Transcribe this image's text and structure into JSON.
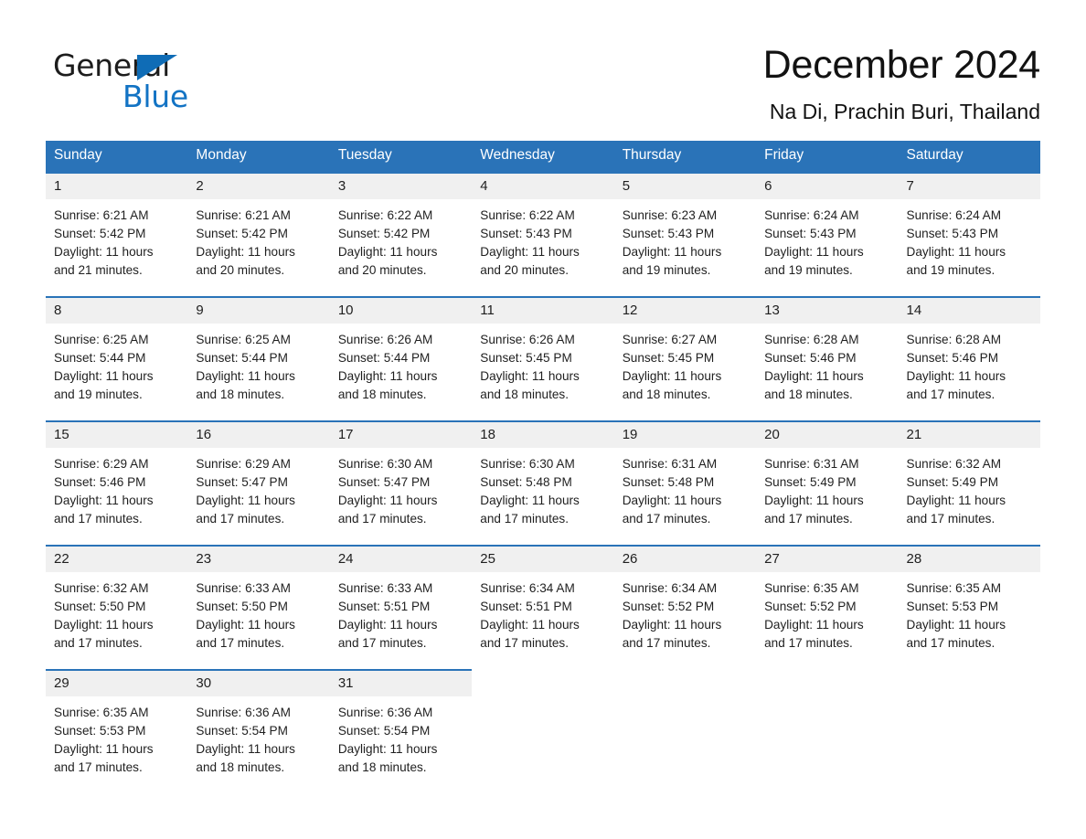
{
  "brand": {
    "word_one": "General",
    "word_two": "Blue",
    "triangle_icon": "triangle-logo-icon"
  },
  "header": {
    "month_title": "December 2024",
    "location": "Na Di, Prachin Buri, Thailand"
  },
  "calendar": {
    "weekday_headers": [
      "Sunday",
      "Monday",
      "Tuesday",
      "Wednesday",
      "Thursday",
      "Friday",
      "Saturday"
    ],
    "accent_color": "#2a73b8",
    "daynum_band_color": "#f0f0f0",
    "weeks": [
      [
        {
          "day": "1",
          "sunrise": "Sunrise: 6:21 AM",
          "sunset": "Sunset: 5:42 PM",
          "daylight_line1": "Daylight: 11 hours",
          "daylight_line2": "and 21 minutes."
        },
        {
          "day": "2",
          "sunrise": "Sunrise: 6:21 AM",
          "sunset": "Sunset: 5:42 PM",
          "daylight_line1": "Daylight: 11 hours",
          "daylight_line2": "and 20 minutes."
        },
        {
          "day": "3",
          "sunrise": "Sunrise: 6:22 AM",
          "sunset": "Sunset: 5:42 PM",
          "daylight_line1": "Daylight: 11 hours",
          "daylight_line2": "and 20 minutes."
        },
        {
          "day": "4",
          "sunrise": "Sunrise: 6:22 AM",
          "sunset": "Sunset: 5:43 PM",
          "daylight_line1": "Daylight: 11 hours",
          "daylight_line2": "and 20 minutes."
        },
        {
          "day": "5",
          "sunrise": "Sunrise: 6:23 AM",
          "sunset": "Sunset: 5:43 PM",
          "daylight_line1": "Daylight: 11 hours",
          "daylight_line2": "and 19 minutes."
        },
        {
          "day": "6",
          "sunrise": "Sunrise: 6:24 AM",
          "sunset": "Sunset: 5:43 PM",
          "daylight_line1": "Daylight: 11 hours",
          "daylight_line2": "and 19 minutes."
        },
        {
          "day": "7",
          "sunrise": "Sunrise: 6:24 AM",
          "sunset": "Sunset: 5:43 PM",
          "daylight_line1": "Daylight: 11 hours",
          "daylight_line2": "and 19 minutes."
        }
      ],
      [
        {
          "day": "8",
          "sunrise": "Sunrise: 6:25 AM",
          "sunset": "Sunset: 5:44 PM",
          "daylight_line1": "Daylight: 11 hours",
          "daylight_line2": "and 19 minutes."
        },
        {
          "day": "9",
          "sunrise": "Sunrise: 6:25 AM",
          "sunset": "Sunset: 5:44 PM",
          "daylight_line1": "Daylight: 11 hours",
          "daylight_line2": "and 18 minutes."
        },
        {
          "day": "10",
          "sunrise": "Sunrise: 6:26 AM",
          "sunset": "Sunset: 5:44 PM",
          "daylight_line1": "Daylight: 11 hours",
          "daylight_line2": "and 18 minutes."
        },
        {
          "day": "11",
          "sunrise": "Sunrise: 6:26 AM",
          "sunset": "Sunset: 5:45 PM",
          "daylight_line1": "Daylight: 11 hours",
          "daylight_line2": "and 18 minutes."
        },
        {
          "day": "12",
          "sunrise": "Sunrise: 6:27 AM",
          "sunset": "Sunset: 5:45 PM",
          "daylight_line1": "Daylight: 11 hours",
          "daylight_line2": "and 18 minutes."
        },
        {
          "day": "13",
          "sunrise": "Sunrise: 6:28 AM",
          "sunset": "Sunset: 5:46 PM",
          "daylight_line1": "Daylight: 11 hours",
          "daylight_line2": "and 18 minutes."
        },
        {
          "day": "14",
          "sunrise": "Sunrise: 6:28 AM",
          "sunset": "Sunset: 5:46 PM",
          "daylight_line1": "Daylight: 11 hours",
          "daylight_line2": "and 17 minutes."
        }
      ],
      [
        {
          "day": "15",
          "sunrise": "Sunrise: 6:29 AM",
          "sunset": "Sunset: 5:46 PM",
          "daylight_line1": "Daylight: 11 hours",
          "daylight_line2": "and 17 minutes."
        },
        {
          "day": "16",
          "sunrise": "Sunrise: 6:29 AM",
          "sunset": "Sunset: 5:47 PM",
          "daylight_line1": "Daylight: 11 hours",
          "daylight_line2": "and 17 minutes."
        },
        {
          "day": "17",
          "sunrise": "Sunrise: 6:30 AM",
          "sunset": "Sunset: 5:47 PM",
          "daylight_line1": "Daylight: 11 hours",
          "daylight_line2": "and 17 minutes."
        },
        {
          "day": "18",
          "sunrise": "Sunrise: 6:30 AM",
          "sunset": "Sunset: 5:48 PM",
          "daylight_line1": "Daylight: 11 hours",
          "daylight_line2": "and 17 minutes."
        },
        {
          "day": "19",
          "sunrise": "Sunrise: 6:31 AM",
          "sunset": "Sunset: 5:48 PM",
          "daylight_line1": "Daylight: 11 hours",
          "daylight_line2": "and 17 minutes."
        },
        {
          "day": "20",
          "sunrise": "Sunrise: 6:31 AM",
          "sunset": "Sunset: 5:49 PM",
          "daylight_line1": "Daylight: 11 hours",
          "daylight_line2": "and 17 minutes."
        },
        {
          "day": "21",
          "sunrise": "Sunrise: 6:32 AM",
          "sunset": "Sunset: 5:49 PM",
          "daylight_line1": "Daylight: 11 hours",
          "daylight_line2": "and 17 minutes."
        }
      ],
      [
        {
          "day": "22",
          "sunrise": "Sunrise: 6:32 AM",
          "sunset": "Sunset: 5:50 PM",
          "daylight_line1": "Daylight: 11 hours",
          "daylight_line2": "and 17 minutes."
        },
        {
          "day": "23",
          "sunrise": "Sunrise: 6:33 AM",
          "sunset": "Sunset: 5:50 PM",
          "daylight_line1": "Daylight: 11 hours",
          "daylight_line2": "and 17 minutes."
        },
        {
          "day": "24",
          "sunrise": "Sunrise: 6:33 AM",
          "sunset": "Sunset: 5:51 PM",
          "daylight_line1": "Daylight: 11 hours",
          "daylight_line2": "and 17 minutes."
        },
        {
          "day": "25",
          "sunrise": "Sunrise: 6:34 AM",
          "sunset": "Sunset: 5:51 PM",
          "daylight_line1": "Daylight: 11 hours",
          "daylight_line2": "and 17 minutes."
        },
        {
          "day": "26",
          "sunrise": "Sunrise: 6:34 AM",
          "sunset": "Sunset: 5:52 PM",
          "daylight_line1": "Daylight: 11 hours",
          "daylight_line2": "and 17 minutes."
        },
        {
          "day": "27",
          "sunrise": "Sunrise: 6:35 AM",
          "sunset": "Sunset: 5:52 PM",
          "daylight_line1": "Daylight: 11 hours",
          "daylight_line2": "and 17 minutes."
        },
        {
          "day": "28",
          "sunrise": "Sunrise: 6:35 AM",
          "sunset": "Sunset: 5:53 PM",
          "daylight_line1": "Daylight: 11 hours",
          "daylight_line2": "and 17 minutes."
        }
      ],
      [
        {
          "day": "29",
          "sunrise": "Sunrise: 6:35 AM",
          "sunset": "Sunset: 5:53 PM",
          "daylight_line1": "Daylight: 11 hours",
          "daylight_line2": "and 17 minutes."
        },
        {
          "day": "30",
          "sunrise": "Sunrise: 6:36 AM",
          "sunset": "Sunset: 5:54 PM",
          "daylight_line1": "Daylight: 11 hours",
          "daylight_line2": "and 18 minutes."
        },
        {
          "day": "31",
          "sunrise": "Sunrise: 6:36 AM",
          "sunset": "Sunset: 5:54 PM",
          "daylight_line1": "Daylight: 11 hours",
          "daylight_line2": "and 18 minutes."
        },
        null,
        null,
        null,
        null
      ]
    ]
  }
}
